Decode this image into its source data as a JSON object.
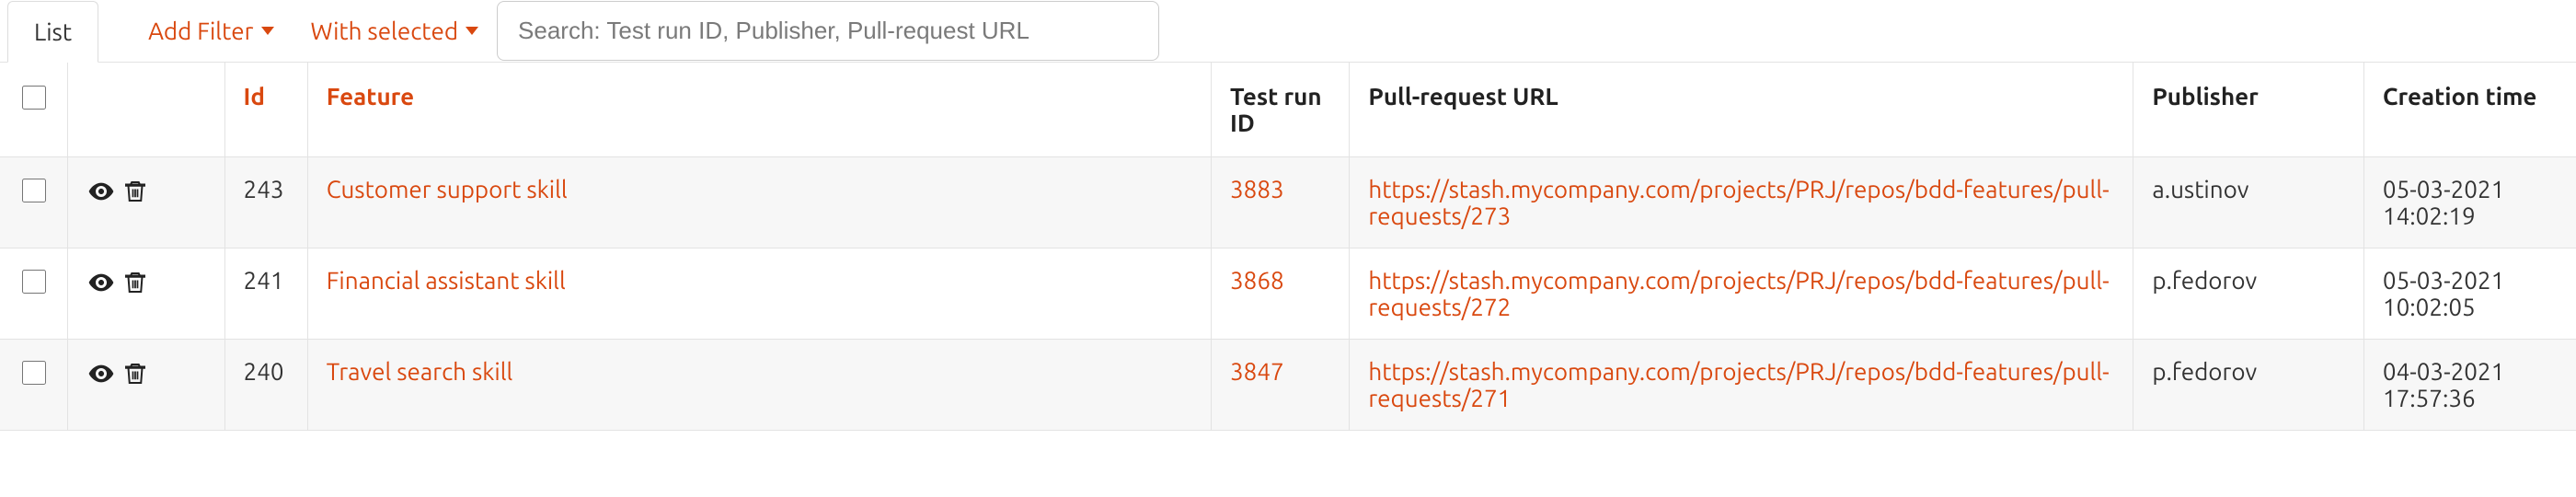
{
  "toolbar": {
    "list_tab": "List",
    "add_filter": "Add Filter",
    "with_selected": "With selected",
    "search_placeholder": "Search: Test run ID, Publisher, Pull-request URL"
  },
  "columns": {
    "id": "Id",
    "feature": "Feature",
    "test_run_id": "Test run ID",
    "pr_url": "Pull-request URL",
    "publisher": "Publisher",
    "created": "Creation time"
  },
  "rows": [
    {
      "id": "243",
      "feature": "Customer support skill",
      "test_run_id": "3883",
      "pr_url": "https://stash.mycompany.com/projects/PRJ/repos/bdd-features/pull-requests/273",
      "publisher": "a.ustinov",
      "created": "05-03-2021 14:02:19"
    },
    {
      "id": "241",
      "feature": "Financial assistant skill",
      "test_run_id": "3868",
      "pr_url": "https://stash.mycompany.com/projects/PRJ/repos/bdd-features/pull-requests/272",
      "publisher": "p.fedorov",
      "created": "05-03-2021 10:02:05"
    },
    {
      "id": "240",
      "feature": "Travel search skill",
      "test_run_id": "3847",
      "pr_url": "https://stash.mycompany.com/projects/PRJ/repos/bdd-features/pull-requests/271",
      "publisher": "p.fedorov",
      "created": "04-03-2021 17:57:36"
    }
  ],
  "colors": {
    "accent": "#d9480f"
  }
}
